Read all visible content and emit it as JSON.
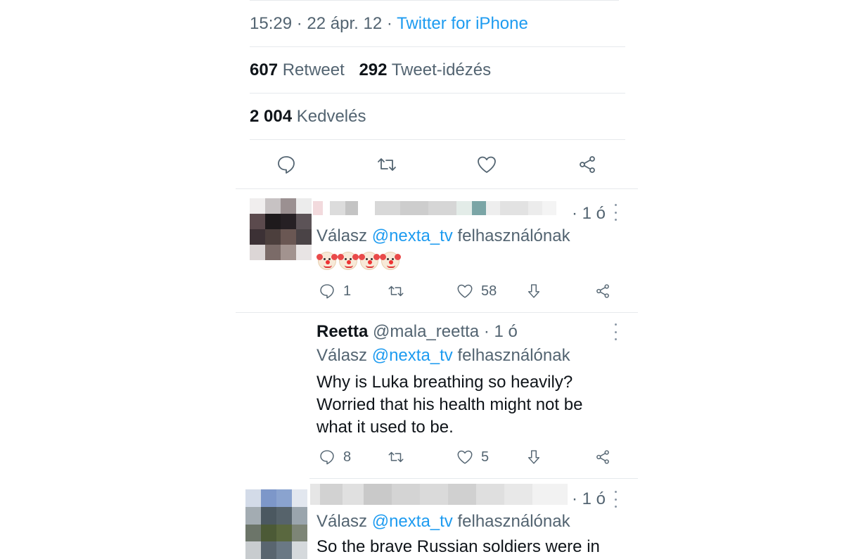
{
  "tweet": {
    "time": "15:29",
    "date": "22 ápr. 12",
    "source": "Twitter for iPhone",
    "retweets_count": "607",
    "retweets_label": "Retweet",
    "quotes_count": "292",
    "quotes_label": "Tweet-idézés",
    "likes_count": "2 004",
    "likes_label": "Kedvelés",
    "actions": [
      "reply-icon",
      "retweet-icon",
      "like-icon",
      "share-icon"
    ]
  },
  "replies": [
    {
      "time": "· 1 ó",
      "reply_prefix": "Válasz",
      "mention": "@nexta_tv",
      "reply_suffix": "felhasználónak",
      "emoji": [
        "clown-face",
        "clown-face",
        "clown-face",
        "clown-face"
      ],
      "reply_count": "1",
      "like_count": "58"
    },
    {
      "name": "Reetta",
      "handle": "@mala_reetta",
      "time": "· 1 ó",
      "reply_prefix": "Válasz",
      "mention": "@nexta_tv",
      "reply_suffix": "felhasználónak",
      "lines": [
        "Why is Luka breathing so heavily?",
        "Worried that his health might not be",
        "what it used to be."
      ],
      "reply_count": "8",
      "like_count": "5"
    },
    {
      "time": "· 1 ó",
      "reply_prefix": "Válasz",
      "mention": "@nexta_tv",
      "reply_suffix": "felhasználónak",
      "lines": [
        "So the brave Russian soldiers were in"
      ]
    }
  ],
  "colors": {
    "accent": "#1d9bf0",
    "muted": "#536471",
    "text": "#0f1419",
    "divider": "#e6e9ec"
  }
}
